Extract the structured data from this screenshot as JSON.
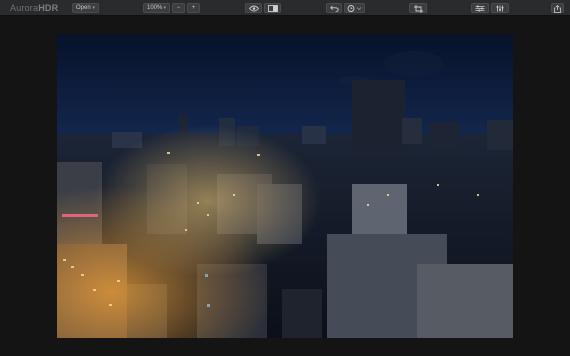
{
  "app": {
    "logo_light": "Aurora",
    "logo_bold": "HDR"
  },
  "toolbar": {
    "open_label": "Open",
    "zoom_value": "100%",
    "zoom_out_label": "−",
    "zoom_in_label": "+"
  },
  "icons": {
    "caret": "▾",
    "preview": "eye-icon",
    "compare": "split-view-icon",
    "undo": "undo-icon",
    "history": "clock-icon",
    "crop": "crop-icon",
    "presets": "sliders-icon",
    "adjust": "adjust-icon",
    "share": "share-icon"
  },
  "colors": {
    "toolbar_bg": "#2a2b2d",
    "canvas_bg": "#141414",
    "sky_top": "#07122a",
    "sky_horizon": "#2b4a78",
    "city_lights": "#f3a43a"
  }
}
